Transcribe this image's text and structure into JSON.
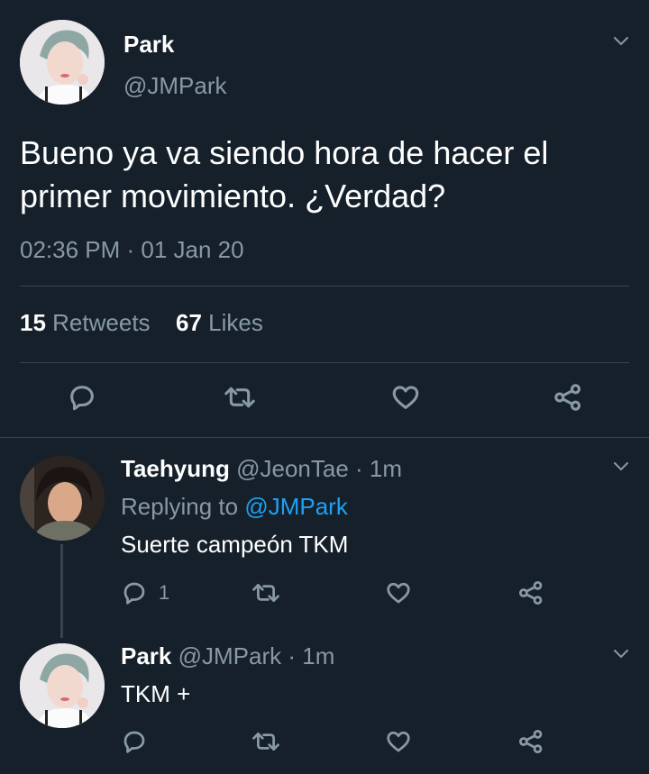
{
  "main_tweet": {
    "display_name": "Park",
    "handle": "@JMPark",
    "text": "Bueno ya va siendo hora de hacer el primer movimiento. ¿Verdad?",
    "timestamp": "02:36 PM · 01 Jan 20",
    "retweets_count": "15",
    "retweets_label": "Retweets",
    "likes_count": "67",
    "likes_label": "Likes"
  },
  "replies": [
    {
      "display_name": "Taehyung",
      "handle": "@JeonTae",
      "time": "· 1m",
      "replying_prefix": "Replying to",
      "replying_handle": "@JMPark",
      "text": "Suerte campeón TKM",
      "reply_count": "1"
    },
    {
      "display_name": "Park",
      "handle": "@JMPark",
      "time": "· 1m",
      "text": "TKM +",
      "reply_count": ""
    }
  ],
  "colors": {
    "background": "#15202b",
    "muted": "#8899a6",
    "link": "#1da1f2",
    "divider": "#38444d"
  },
  "icons": [
    "chevron-down-icon",
    "reply-icon",
    "retweet-icon",
    "like-icon",
    "share-icon"
  ]
}
